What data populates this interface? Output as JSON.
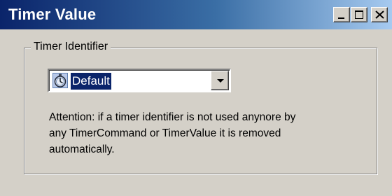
{
  "window": {
    "title": "Timer Value",
    "controls": {
      "minimize_icon": "minimize-icon",
      "maximize_icon": "maximize-icon",
      "close_icon": "close-icon"
    }
  },
  "group": {
    "label": "Timer Identifier"
  },
  "combo": {
    "icon": "stopwatch-icon",
    "selected": "Default"
  },
  "note": {
    "lines": [
      "Attention: if a timer identifier is not used anynore by",
      "any TimerCommand or TimerValue it is removed",
      "automatically."
    ]
  },
  "colors": {
    "title_bar_start": "#0a246a",
    "title_bar_end": "#a6caf0",
    "face": "#d4d0c8",
    "selection": "#0a246a"
  }
}
